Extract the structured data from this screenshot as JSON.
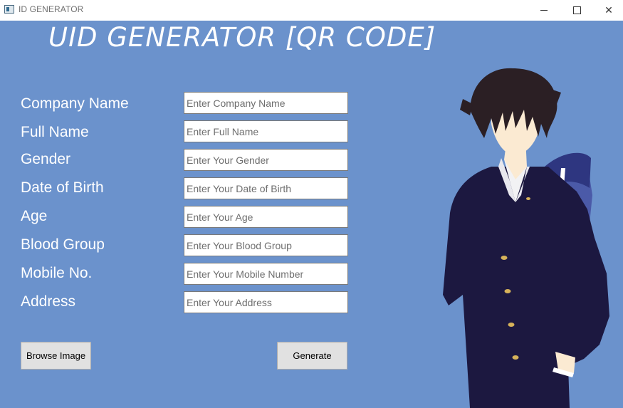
{
  "window": {
    "title": "ID GENERATOR",
    "controls": {
      "minimize": "minimize",
      "maximize": "maximize",
      "close": "✕"
    }
  },
  "heading": "UID GENERATOR [QR CODE]",
  "form": {
    "fields": [
      {
        "label": "Company Name",
        "placeholder": "Enter Company Name",
        "value": ""
      },
      {
        "label": "Full Name",
        "placeholder": "Enter Full Name",
        "value": ""
      },
      {
        "label": "Gender",
        "placeholder": "Enter Your Gender",
        "value": ""
      },
      {
        "label": "Date of Birth",
        "placeholder": "Enter Your Date of Birth",
        "value": ""
      },
      {
        "label": "Age",
        "placeholder": "Enter Your Age",
        "value": ""
      },
      {
        "label": "Blood Group",
        "placeholder": "Enter Your Blood Group",
        "value": ""
      },
      {
        "label": "Mobile No.",
        "placeholder": "Enter Your Mobile Number",
        "value": ""
      },
      {
        "label": "Address",
        "placeholder": "Enter Your Address",
        "value": ""
      }
    ]
  },
  "buttons": {
    "browse": "Browse Image",
    "generate": "Generate"
  },
  "colors": {
    "background": "#6b92cc",
    "heading": "#ffffff",
    "label": "#ffffff",
    "button": "#e1e1e1"
  },
  "illustration": "anime-student-in-uniform-with-bag"
}
